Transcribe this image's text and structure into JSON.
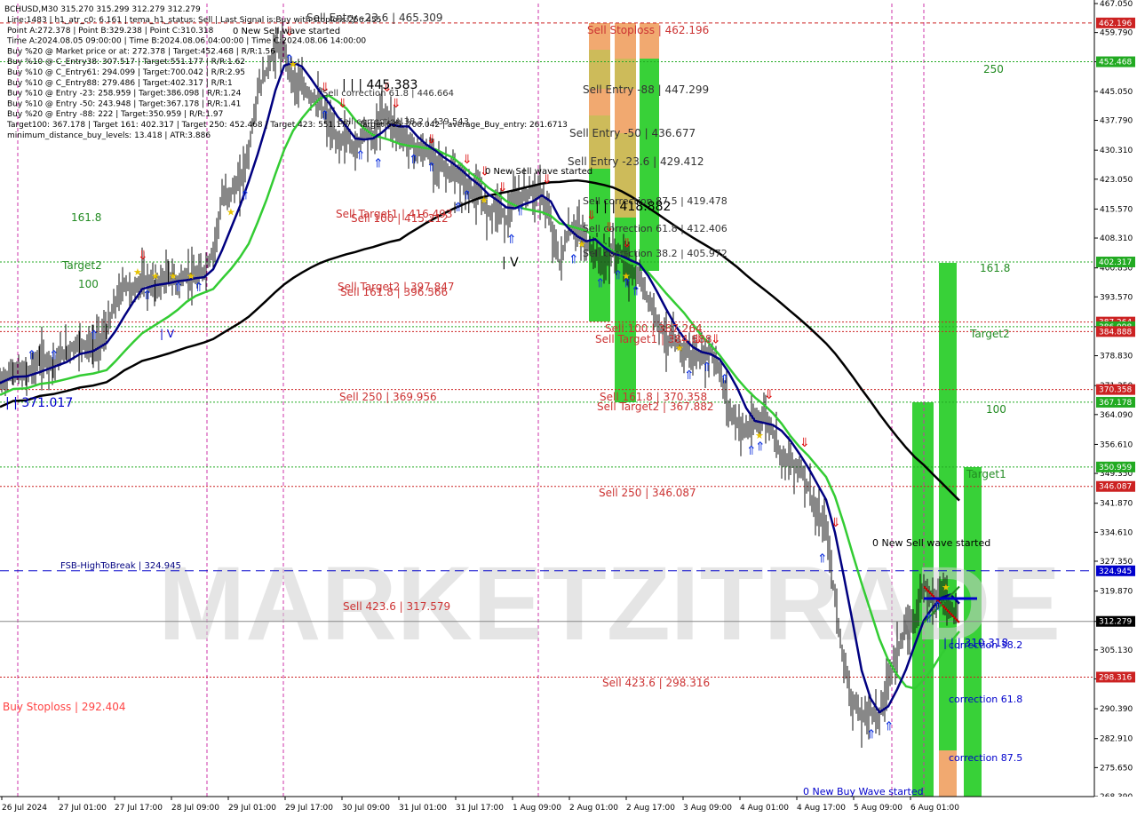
{
  "header": {
    "symbol_line": "BCHUSD,M30  315.270 315.299 312.279 312.279",
    "info_lines": [
      "Line:1483  | h1_atr_c0: 6.161  | tema_h1_status: Sell  | Last Signal is:Buy with stoploss:256.455",
      "Point A:272.378  | Point B:329.238  | Point C:310.318",
      "Time A:2024.08.05 09:00:00  | Time B:2024.08.06 04:00:00  | Time C:2024.08.06 14:00:00",
      "Buy %20 @ Market price or at: 272.378  | Target:452.468  | R/R:1.56",
      "Buy %10 @ C_Entry38: 307.517  | Target:551.177  | R/R:1.62",
      "Buy %10 @ C_Entry61: 294.099  | Target:700.042  | R/R:2.95",
      "Buy %10 @ C_Entry88: 279.486  | Target:402.317  | R/R:1",
      "Buy %10 @ Entry -23: 258.959  | Target:386.098  | R/R:1.24",
      "Buy %10 @ Entry -50: 243.948  | Target:367.178  | R/R:1.41",
      "Buy %20 @ Entry -88: 222  | Target:350.959  | R/R:1.97",
      "Target100: 367.178  | Target 161: 402.317  | Target 250: 452.468  | Target 423: 551.177  | Target 685: 700.042  | average_Buy_entry: 261.6713",
      "minimum_distance_buy_levels: 13.418  | ATR:3.886"
    ]
  },
  "watermark": "MARKETZITRADE",
  "colors": {
    "up_green": "#33cc33",
    "red_line": "#cc0000",
    "dark_green_line": "#228b22",
    "blue_line": "#0000cc",
    "sma_navy": "#000080",
    "ema_green": "#33cc33",
    "ma_black": "#000000",
    "orange_zone": "#f0a060",
    "olive_zone": "#c8b448"
  },
  "chart_data": {
    "type": "candlestick",
    "symbol": "BCHUSD",
    "timeframe": "M30",
    "ylim": [
      268.39,
      467.05
    ],
    "y_ticks": [
      "467.050",
      "459.790",
      "452.468",
      "445.050",
      "437.790",
      "430.310",
      "423.050",
      "415.570",
      "408.310",
      "400.830",
      "393.570",
      "386.098",
      "378.830",
      "371.350",
      "364.090",
      "356.610",
      "349.350",
      "341.870",
      "334.610",
      "327.350",
      "319.870",
      "312.279",
      "305.130",
      "297.870",
      "290.390",
      "282.910",
      "275.650",
      "268.390"
    ],
    "x_ticks": [
      "26 Jul 2024",
      "27 Jul 01:00",
      "27 Jul 17:00",
      "28 Jul 09:00",
      "29 Jul 01:00",
      "29 Jul 17:00",
      "30 Jul 09:00",
      "31 Jul 01:00",
      "31 Jul 17:00",
      "1 Aug 09:00",
      "2 Aug 01:00",
      "2 Aug 17:00",
      "3 Aug 09:00",
      "4 Aug 01:00",
      "4 Aug 17:00",
      "5 Aug 09:00",
      "6 Aug 01:00"
    ],
    "price_tags": [
      {
        "value": 462.196,
        "text": "462.196",
        "color": "#cc2222"
      },
      {
        "value": 452.468,
        "text": "452.468",
        "color": "#22aa22"
      },
      {
        "value": 402.317,
        "text": "402.317",
        "color": "#22aa22"
      },
      {
        "value": 387.264,
        "text": "387.264",
        "color": "#cc2222"
      },
      {
        "value": 386.098,
        "text": "386.098",
        "color": "#22aa22"
      },
      {
        "value": 384.888,
        "text": "384.888",
        "color": "#cc2222"
      },
      {
        "value": 370.358,
        "text": "370.358",
        "color": "#cc2222"
      },
      {
        "value": 367.178,
        "text": "367.178",
        "color": "#22aa22"
      },
      {
        "value": 350.959,
        "text": "350.959",
        "color": "#22aa22"
      },
      {
        "value": 346.087,
        "text": "346.087",
        "color": "#cc2222"
      },
      {
        "value": 324.945,
        "text": "324.945",
        "color": "#0000cc"
      },
      {
        "value": 312.279,
        "text": "312.279",
        "color": "#000000"
      },
      {
        "value": 298.316,
        "text": "298.316",
        "color": "#cc2222"
      }
    ],
    "hlines": [
      {
        "value": 462.196,
        "color": "#cc2222",
        "dash": "4,3"
      },
      {
        "value": 452.468,
        "color": "#22aa22",
        "dash": "2,2"
      },
      {
        "value": 402.317,
        "color": "#22aa22",
        "dash": "2,2"
      },
      {
        "value": 387.264,
        "color": "#cc2222",
        "dash": "2,2"
      },
      {
        "value": 386.098,
        "color": "#22aa22",
        "dash": "2,2"
      },
      {
        "value": 384.888,
        "color": "#cc2222",
        "dash": "2,2"
      },
      {
        "value": 370.358,
        "color": "#cc2222",
        "dash": "2,2"
      },
      {
        "value": 367.178,
        "color": "#22aa22",
        "dash": "2,2"
      },
      {
        "value": 350.959,
        "color": "#22aa22",
        "dash": "2,2"
      },
      {
        "value": 346.087,
        "color": "#cc2222",
        "dash": "2,2"
      },
      {
        "value": 324.945,
        "color": "#0000cc",
        "dash": "10,6"
      },
      {
        "value": 312.279,
        "color": "#888888",
        "dash": ""
      },
      {
        "value": 298.316,
        "color": "#cc2222",
        "dash": "2,2"
      }
    ],
    "labels": [
      {
        "text": "Sell Entry -23.6 | 465.309",
        "color": "#333333"
      },
      {
        "text": "0 New Sell wave started",
        "color": "#000000"
      },
      {
        "text": "Sell Stoploss | 462.196",
        "color": "#cc3333"
      },
      {
        "text": "250",
        "color": "#228b22"
      },
      {
        "text": "Sell Entry -88 | 447.299",
        "color": "#333333"
      },
      {
        "text": "| | |  445.383",
        "color": "#000000"
      },
      {
        "text": "Sell correction 61.8 | 446.664",
        "color": "#333333"
      },
      {
        "text": "Sell correction 38.2 | 439.543",
        "color": "#333333"
      },
      {
        "text": "Sell Entry -50 | 436.677",
        "color": "#333333"
      },
      {
        "text": "Sell Entry -23.6 | 429.412",
        "color": "#333333"
      },
      {
        "text": "0 New Sell wave started",
        "color": "#000000"
      },
      {
        "text": "161.8",
        "color": "#228b22"
      },
      {
        "text": "Sell Target1 | 416.493",
        "color": "#cc3333"
      },
      {
        "text": "Sell 100 | 415.212",
        "color": "#cc3333"
      },
      {
        "text": "Sell correction 87.5 | 419.478",
        "color": "#333333"
      },
      {
        "text": "| | | 418.882",
        "color": "#000000"
      },
      {
        "text": "Sell correction 61.8 | 412.406",
        "color": "#333333"
      },
      {
        "text": "Sell correction 38.2 | 405.972",
        "color": "#333333"
      },
      {
        "text": "Target2",
        "color": "#228b22"
      },
      {
        "text": "161.8",
        "color": "#228b22"
      },
      {
        "text": "100",
        "color": "#228b22"
      },
      {
        "text": "Sell Target2 | 397.847",
        "color": "#cc3333"
      },
      {
        "text": "Sell 161.8 | 396.566",
        "color": "#cc3333"
      },
      {
        "text": "Sell 100 | 387.264",
        "color": "#cc3333"
      },
      {
        "text": "Sell Target1 | 384.888",
        "color": "#cc3333"
      },
      {
        "text": "Target2",
        "color": "#228b22"
      },
      {
        "text": "| | 371.017",
        "color": "#0000cc"
      },
      {
        "text": "Sell 250 | 369.956",
        "color": "#cc3333"
      },
      {
        "text": "Sell 161.8 | 370.358",
        "color": "#cc3333"
      },
      {
        "text": "Sell Target2 | 367.882",
        "color": "#cc3333"
      },
      {
        "text": "100",
        "color": "#228b22"
      },
      {
        "text": "Target1",
        "color": "#228b22"
      },
      {
        "text": "Sell 250 | 346.087",
        "color": "#cc3333"
      },
      {
        "text": "0 New Sell wave started",
        "color": "#000000"
      },
      {
        "text": "FSB-HighToBreak | 324.945",
        "color": "#000080"
      },
      {
        "text": "Sell 423.6 | 317.579",
        "color": "#cc3333"
      },
      {
        "text": "| | | 310.318",
        "color": "#0000cc"
      },
      {
        "text": "correction 38.2",
        "color": "#0000cc"
      },
      {
        "text": "Sell 423.6 | 298.316",
        "color": "#cc3333"
      },
      {
        "text": "Buy Stoploss | 292.404",
        "color": "#ff4444"
      },
      {
        "text": "correction 61.8",
        "color": "#0000cc"
      },
      {
        "text": "correction 87.5",
        "color": "#0000cc"
      },
      {
        "text": "0 New Buy Wave started",
        "color": "#0000cc"
      },
      {
        "text": "| V",
        "color": "#0000cc"
      },
      {
        "text": "| V",
        "color": "#000000"
      },
      {
        "text": "| | |",
        "color": "#000000"
      }
    ]
  }
}
